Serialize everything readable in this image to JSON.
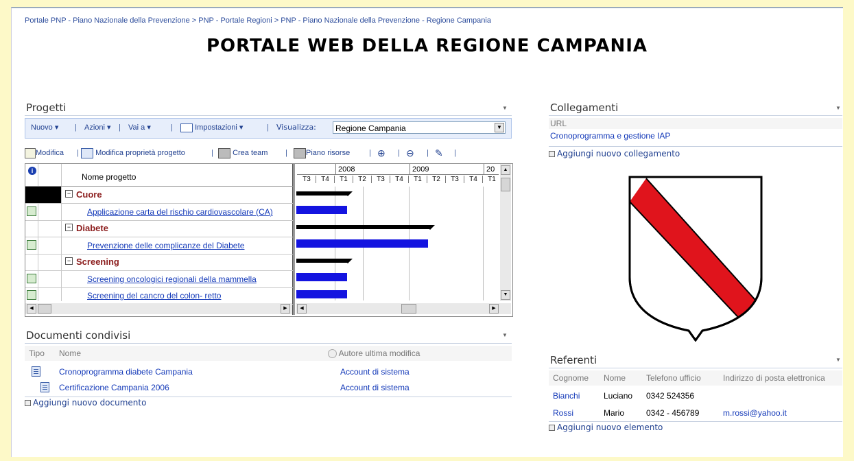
{
  "breadcrumb": {
    "item1": "Portale PNP - Piano Nazionale della Prevenzione",
    "sep": " > ",
    "item2": "PNP - Portale Regioni",
    "item3": "PNP - Piano Nazionale della Prevenzione - Regione Campania"
  },
  "page_title": "PORTALE WEB DELLA REGIONE CAMPANIA",
  "progetti": {
    "title": "Progetti",
    "toolbar1": {
      "nuovo": "Nuovo",
      "azioni": "Azioni",
      "vai_a": "Vai a",
      "impostazioni": "Impostazioni",
      "visualizza_label": "Visualizza:",
      "visualizza_value": "Regione Campania"
    },
    "toolbar2": {
      "modifica": "Modifica",
      "modifica_proprieta": "Modifica proprietà progetto",
      "crea_team": "Crea team",
      "piano_risorse": "Piano risorse"
    },
    "column_header": "Nome progetto",
    "gantt": {
      "years": [
        "2008",
        "2009",
        "20"
      ],
      "quarters": [
        "T3",
        "T4",
        "T1",
        "T2",
        "T3",
        "T4",
        "T1",
        "T2",
        "T3",
        "T4",
        "T1"
      ]
    },
    "rows": [
      {
        "type": "category",
        "label": "Cuore"
      },
      {
        "type": "project",
        "label": "Applicazione carta del rischio cardiovascolare (CA)"
      },
      {
        "type": "category",
        "label": "Diabete"
      },
      {
        "type": "project",
        "label": "Prevenzione delle complicanze del Diabete"
      },
      {
        "type": "category",
        "label": "Screening"
      },
      {
        "type": "project",
        "label": "Screening oncologici regionali della mammella"
      },
      {
        "type": "project",
        "label": "Screening del cancro del colon- retto"
      }
    ]
  },
  "documenti": {
    "title": "Documenti condivisi",
    "col_tipo": "Tipo",
    "col_nome": "Nome",
    "col_autore": "Autore ultima modifica",
    "items": [
      {
        "nome": "Cronoprogramma diabete Campania",
        "autore": "Account di sistema"
      },
      {
        "nome": "Certificazione Campania 2006",
        "autore": "Account di sistema"
      }
    ],
    "add": "Aggiungi nuovo documento"
  },
  "collegamenti": {
    "title": "Collegamenti",
    "col_url": "URL",
    "link": "Cronoprogramma e gestione IAP",
    "add": "Aggiungi nuovo collegamento"
  },
  "referenti": {
    "title": "Referenti",
    "cols": {
      "cognome": "Cognome",
      "nome": "Nome",
      "telefono": "Telefono ufficio",
      "email": "Indirizzo di posta elettronica"
    },
    "rows": [
      {
        "cognome": "Bianchi",
        "nome": "Luciano",
        "telefono": "0342 524356",
        "email": ""
      },
      {
        "cognome": "Rossi",
        "nome": "Mario",
        "telefono": "0342 - 456789",
        "email": "m.rossi@yahoo.it"
      }
    ],
    "add": "Aggiungi nuovo elemento"
  },
  "colors": {
    "accent_blue": "#1238b8",
    "category_red": "#8b1c1c",
    "gantt_bar": "#1414e0",
    "background_yellow": "#fdf9c8"
  }
}
